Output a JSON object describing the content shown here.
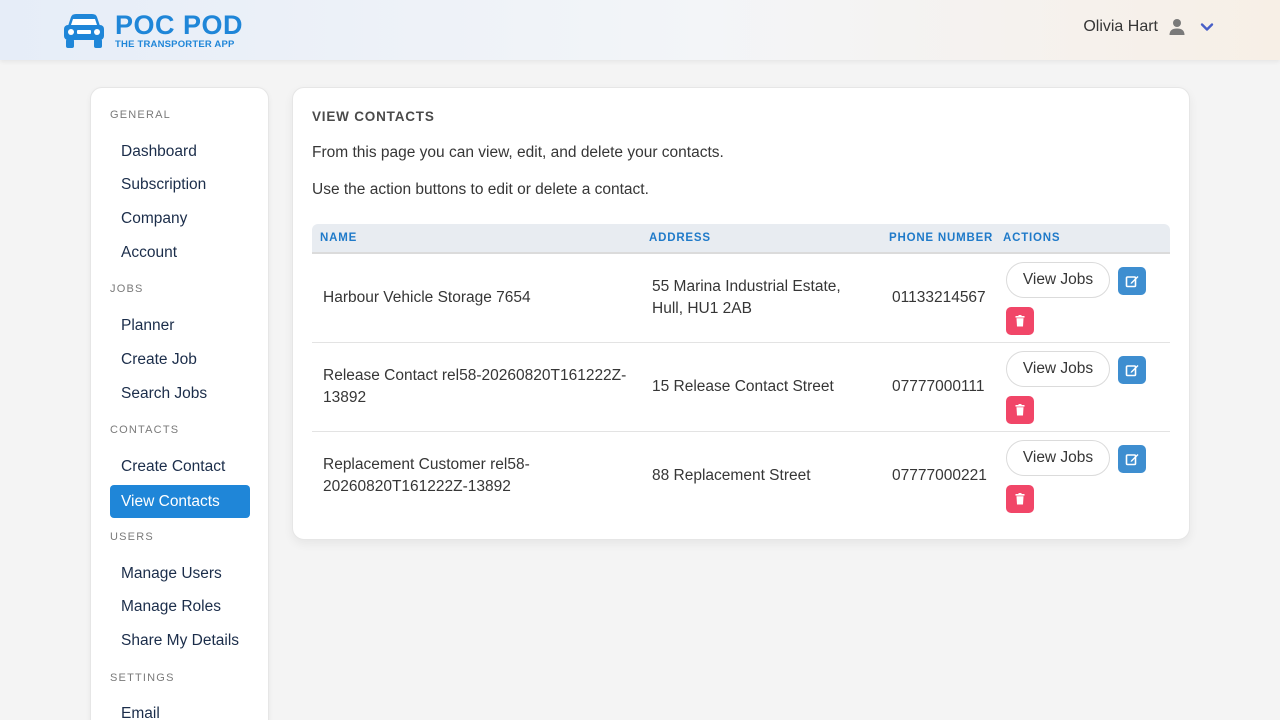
{
  "brand": {
    "name": "POC POD",
    "tagline": "THE TRANSPORTER APP",
    "color": "#1f86d8"
  },
  "user": {
    "name": "Olivia Hart"
  },
  "sidebar": {
    "sections": [
      {
        "label": "GENERAL",
        "items": [
          "Dashboard",
          "Subscription",
          "Company",
          "Account"
        ]
      },
      {
        "label": "JOBS",
        "items": [
          "Planner",
          "Create Job",
          "Search Jobs"
        ]
      },
      {
        "label": "CONTACTS",
        "items": [
          "Create Contact",
          "View Contacts"
        ]
      },
      {
        "label": "USERS",
        "items": [
          "Manage Users",
          "Manage Roles",
          "Share My Details"
        ]
      },
      {
        "label": "SETTINGS",
        "items": [
          "Email"
        ]
      }
    ],
    "active_item": "View Contacts"
  },
  "main": {
    "title": "VIEW CONTACTS",
    "description_1": "From this page you can view, edit, and delete your contacts.",
    "description_2": "Use the action buttons to edit or delete a contact.",
    "table": {
      "headers": [
        "NAME",
        "ADDRESS",
        "PHONE NUMBER",
        "ACTIONS"
      ],
      "rows": [
        {
          "name": "Harbour Vehicle Storage 7654",
          "address_line1": "55 Marina Industrial Estate,",
          "address_line2": "Hull, HU1 2AB",
          "phone": "01133214567",
          "view_label": "View Jobs"
        },
        {
          "name_line1": "Release Contact rel58-20260820T161222Z-",
          "name_line2": "13892",
          "address": "15 Release Contact Street",
          "phone": "07777000111",
          "view_label": "View Jobs"
        },
        {
          "name_line1": "Replacement Customer rel58-",
          "name_line2": "20260820T161222Z-13892",
          "address": "88 Replacement Street",
          "phone": "07777000221",
          "view_label": "View Jobs"
        }
      ]
    }
  },
  "colors": {
    "accent": "#1f86d8",
    "edit": "#3e8ed0",
    "delete": "#f14668",
    "header_text": "#1f7ac9"
  }
}
